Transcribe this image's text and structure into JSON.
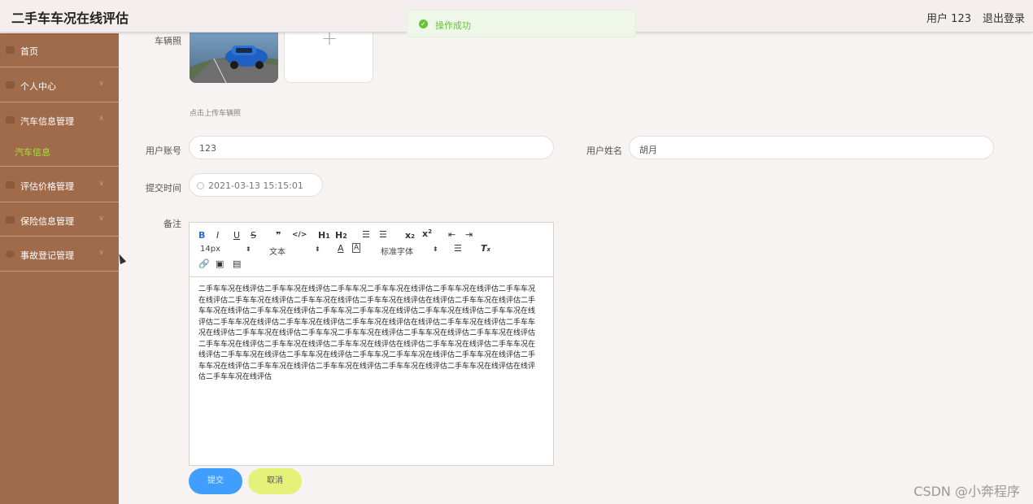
{
  "app": {
    "title": "二手车车况在线评估"
  },
  "header": {
    "user": "用户 123",
    "logout": "退出登录"
  },
  "toast": {
    "message": "操作成功",
    "color": "#67c23a"
  },
  "sidebar": {
    "items": [
      {
        "label": "首页",
        "icon": "home-icon",
        "expandable": false
      },
      {
        "label": "个人中心",
        "icon": "user-icon",
        "expandable": true
      },
      {
        "label": "汽车信息管理",
        "icon": "message-icon",
        "expandable": true,
        "expanded": true
      },
      {
        "label": "评估价格管理",
        "icon": "folder-icon",
        "expandable": true
      },
      {
        "label": "保险信息管理",
        "icon": "message-icon",
        "expandable": true
      },
      {
        "label": "事故登记管理",
        "icon": "settings-icon",
        "expandable": true
      }
    ],
    "subitems": [
      {
        "label": "汽车信息",
        "active": true
      }
    ]
  },
  "form": {
    "photo_label": "车辆照",
    "photo_hint": "点击上传车辆照",
    "account_label": "用户账号",
    "account_value": "123",
    "name_label": "用户姓名",
    "name_value": "胡月",
    "time_label": "提交时间",
    "time_value": "2021-03-13 15:15:01",
    "remark_label": "备注",
    "remark_text": "二手车车况在线评估二手车车况在线评估二手车车况二手车车况在线评估二手车车况在线评估二手车车况在线评估二手车车况在线评估二手车车况在线评估二手车车况在线评估在线评估二手车车况在线评估二手车车况在线评估二手车车况在线评估二手车车况二手车车况在线评估二手车车况在线评估二手车车况在线评估二手车车况在线评估二手车车况在线评估二手车车况在线评估在线评估二手车车况在线评估二手车车况在线评估二手车车况在线评估二手车车况二手车车况在线评估二手车车况在线评估二手车车况在线评估二手车车况在线评估二手车车况在线评估二手车车况在线评估在线评估二手车车况在线评估二手车车况在线评估二手车车况在线评估二手车车况在线评估二手车车况二手车车况在线评估二手车车况在线评估二手车车况在线评估二手车车况在线评估二手车车况在线评估二手车车况在线评估二手车车况在线评估在线评估二手车车况在线评估"
  },
  "editor": {
    "font_size": "14px",
    "text_type": "文本",
    "font_family": "标准字体"
  },
  "buttons": {
    "submit": "提交",
    "cancel": "取消"
  },
  "watermark": "CSDN @小奔程序"
}
